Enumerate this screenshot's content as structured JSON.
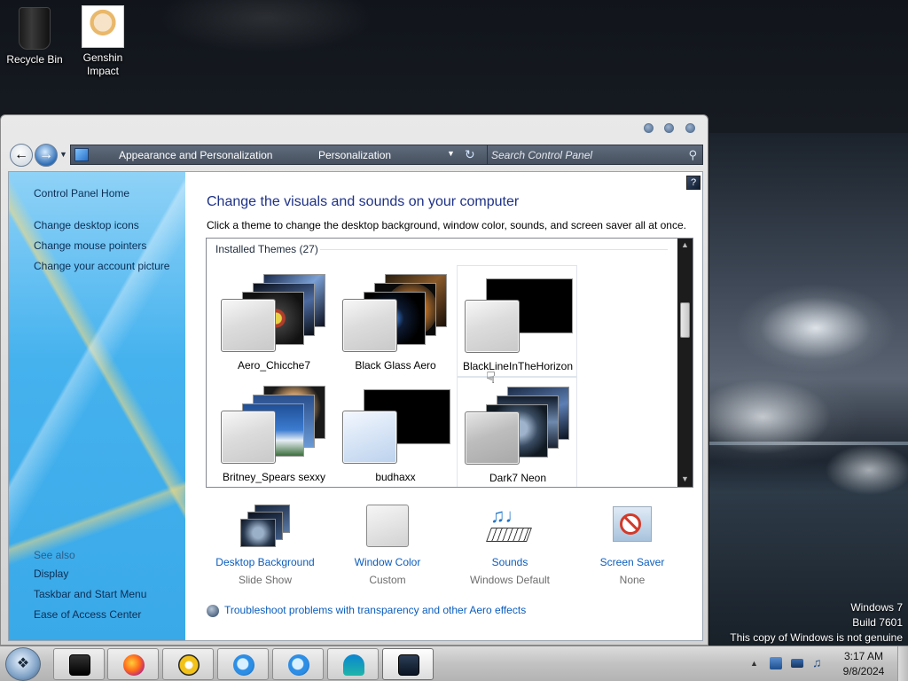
{
  "desktop": {
    "icons": [
      {
        "label_line1": "Recycle Bin",
        "label_line2": ""
      },
      {
        "label_line1": "Genshin",
        "label_line2": "Impact"
      }
    ],
    "watermark": {
      "line1": "Windows 7",
      "line2": "Build 7601",
      "line3": "This copy of Windows is not genuine"
    }
  },
  "window": {
    "address": {
      "crumb1": "Appearance and Personalization",
      "crumb2": "Personalization"
    },
    "search": {
      "placeholder": "Search Control Panel"
    },
    "left_pane": {
      "home": "Control Panel Home",
      "links": [
        "Change desktop icons",
        "Change mouse pointers",
        "Change your account picture"
      ],
      "see_also_title": "See also",
      "see_also": [
        "Display",
        "Taskbar and Start Menu",
        "Ease of Access Center"
      ]
    },
    "main": {
      "title": "Change the visuals and sounds on your computer",
      "subtitle": "Click a theme to change the desktop background, window color, sounds, and screen saver all at once.",
      "installed_label": "Installed Themes (27)",
      "themes": [
        {
          "name": "Aero_Chicche7"
        },
        {
          "name": "Black Glass Aero"
        },
        {
          "name": "BlackLineInTheHorizon"
        },
        {
          "name": "Britney_Spears sexxy"
        },
        {
          "name": "budhaxx"
        },
        {
          "name": "Dark7 Neon"
        }
      ],
      "shortcuts": [
        {
          "label": "Desktop Background",
          "value": "Slide Show"
        },
        {
          "label": "Window Color",
          "value": "Custom"
        },
        {
          "label": "Sounds",
          "value": "Windows Default"
        },
        {
          "label": "Screen Saver",
          "value": "None"
        }
      ],
      "troubleshoot": "Troubleshoot problems with transparency and other Aero effects"
    }
  },
  "taskbar": {
    "clock_time": "3:17 AM",
    "clock_date": "9/8/2024"
  },
  "colors": {
    "link": "#0b5dbd",
    "title": "#1e3287",
    "accent": "#45b2ee"
  }
}
